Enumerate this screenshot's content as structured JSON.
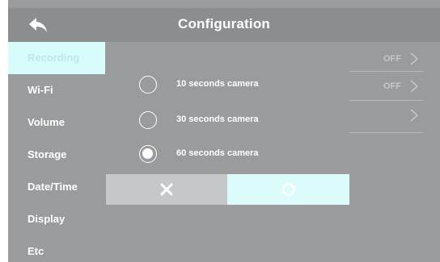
{
  "header": {
    "title": "Configuration",
    "back_icon": "back-arrow-icon"
  },
  "sidebar": {
    "items": [
      {
        "label": "Recording",
        "active": true
      },
      {
        "label": "Wi-Fi",
        "active": false
      },
      {
        "label": "Volume",
        "active": false
      },
      {
        "label": "Storage",
        "active": false
      },
      {
        "label": "Date/Time",
        "active": false
      },
      {
        "label": "Display",
        "active": false
      },
      {
        "label": "Etc",
        "active": false
      }
    ]
  },
  "settings_rows": [
    {
      "value": "OFF",
      "icon": "chevron-right-icon"
    },
    {
      "value": "OFF",
      "icon": "chevron-right-icon"
    },
    {
      "value": "",
      "icon": "chevron-right-icon"
    }
  ],
  "dialog": {
    "options": [
      {
        "label": "10 seconds camera",
        "selected": false
      },
      {
        "label": "30 seconds camera",
        "selected": false
      },
      {
        "label": "60 seconds camera",
        "selected": true
      }
    ],
    "cancel_icon": "close-icon",
    "confirm_icon": "circle-ok-icon"
  },
  "colors": {
    "background": "#9a9b9c",
    "header": "#8c8d8e",
    "accent": "#d8fbfb",
    "text": "#ffffff"
  }
}
